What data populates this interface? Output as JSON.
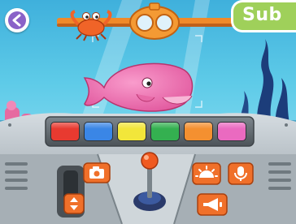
{
  "header": {
    "tab_label": "Sub"
  },
  "colors": {
    "water": "#5fc6e6",
    "panel": "#b9c2c8",
    "accent_orange": "#f0702a",
    "whale_pink": "#f07ab4"
  },
  "color_buttons": [
    {
      "name": "red",
      "color": "#e83a30"
    },
    {
      "name": "blue",
      "color": "#3a86e6"
    },
    {
      "name": "yellow",
      "color": "#f2e63a"
    },
    {
      "name": "green",
      "color": "#34b050"
    },
    {
      "name": "orange",
      "color": "#f49030"
    },
    {
      "name": "pink",
      "color": "#ea6ac0"
    }
  ],
  "controls": {
    "camera_icon": "camera-icon",
    "sun_icon": "sun-icon",
    "microphone_icon": "microphone-icon",
    "horn_icon": "horn-icon",
    "updown_icon": "up-down-arrows-icon",
    "back_icon": "back-arrow-icon"
  }
}
